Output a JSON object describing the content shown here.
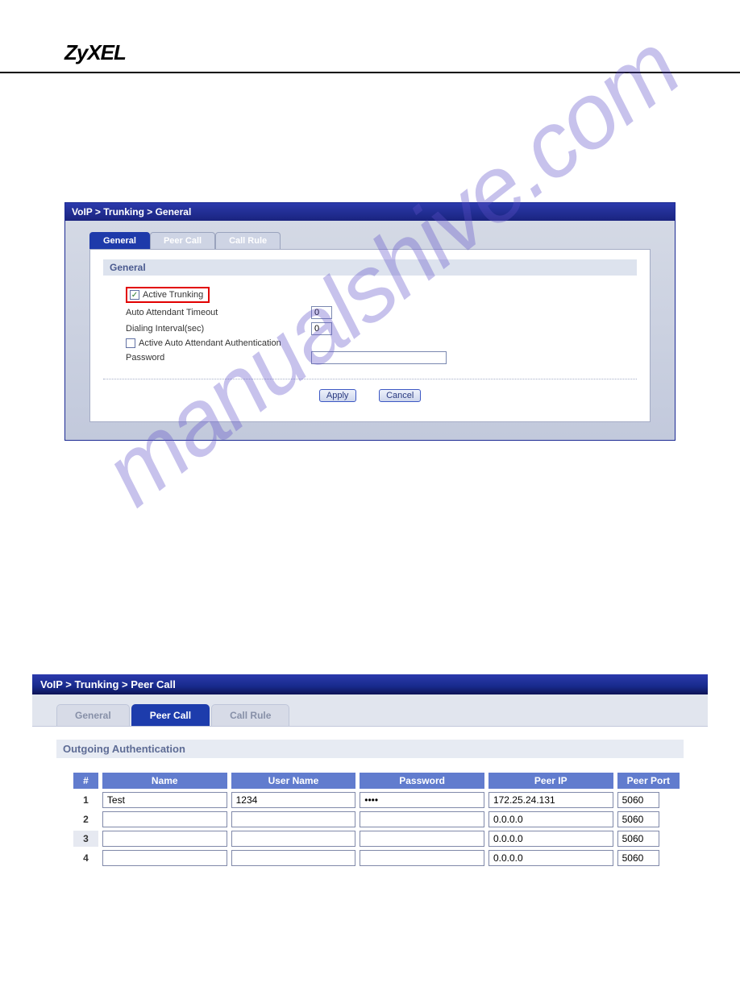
{
  "brand": "ZyXEL",
  "watermark": "manualshive.com",
  "panel1": {
    "breadcrumb": "VoIP > Trunking > General",
    "tabs": [
      "General",
      "Peer Call",
      "Call Rule"
    ],
    "section_title": "General",
    "active_trunking_label": "Active Trunking",
    "auto_attendant_timeout_label": "Auto Attendant Timeout",
    "auto_attendant_timeout_value": "0",
    "dialing_interval_label": "Dialing Interval(sec)",
    "dialing_interval_value": "0",
    "active_auto_attendant_auth_label": "Active Auto Attendant Authentication",
    "password_label": "Password",
    "apply_btn": "Apply",
    "cancel_btn": "Cancel"
  },
  "panel2": {
    "breadcrumb": "VoIP > Trunking > Peer Call",
    "tabs": [
      "General",
      "Peer Call",
      "Call Rule"
    ],
    "section_title": "Outgoing Authentication",
    "headers": {
      "num": "#",
      "name": "Name",
      "user": "User Name",
      "pwd": "Password",
      "ip": "Peer IP",
      "port": "Peer Port"
    },
    "rows": [
      {
        "num": "1",
        "name": "Test",
        "user": "1234",
        "pwd": "••••",
        "ip": "172.25.24.131",
        "port": "5060"
      },
      {
        "num": "2",
        "name": "",
        "user": "",
        "pwd": "",
        "ip": "0.0.0.0",
        "port": "5060"
      },
      {
        "num": "3",
        "name": "",
        "user": "",
        "pwd": "",
        "ip": "0.0.0.0",
        "port": "5060"
      },
      {
        "num": "4",
        "name": "",
        "user": "",
        "pwd": "",
        "ip": "0.0.0.0",
        "port": "5060"
      }
    ]
  }
}
